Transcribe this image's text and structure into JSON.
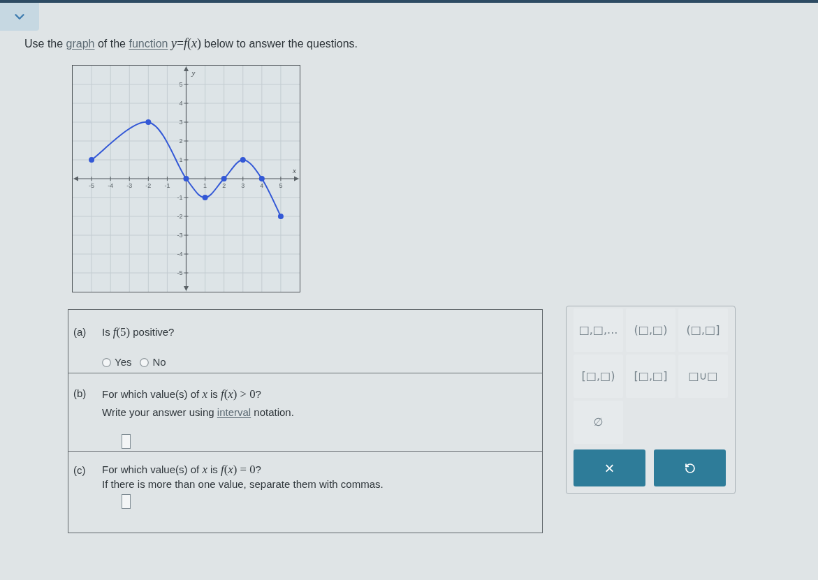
{
  "instruction": {
    "segments": [
      {
        "kind": "text",
        "text": "Use the "
      },
      {
        "kind": "link",
        "text": "graph"
      },
      {
        "kind": "text",
        "text": " of the "
      },
      {
        "kind": "link",
        "text": "function"
      },
      {
        "kind": "math",
        "text": " *y*=*f*(*x*)"
      },
      {
        "kind": "text",
        "text": " below to answer the questions."
      }
    ]
  },
  "graph": {
    "chart_data": [
      {
        "type": "line",
        "xlabel": "x",
        "ylabel": "y",
        "x": [
          -5,
          -2,
          0,
          1,
          2,
          3,
          4,
          5
        ],
        "values": [
          1,
          3,
          0,
          -1,
          0,
          1,
          0,
          -2
        ],
        "color": "#3358d6",
        "marker": "circle",
        "xlim": [
          -6,
          6
        ],
        "ylim": [
          -6,
          6
        ],
        "xticks": [
          -5,
          -4,
          -3,
          -2,
          -1,
          1,
          2,
          3,
          4,
          5
        ],
        "yticks": [
          -5,
          -4,
          -3,
          -2,
          -1,
          1,
          2,
          3,
          4,
          5
        ],
        "grid": true
      }
    ]
  },
  "questions": [
    {
      "label": "(a)",
      "lines": [
        {
          "segments": [
            {
              "kind": "text",
              "text": "Is "
            },
            {
              "kind": "math",
              "text": "*f*(5)"
            },
            {
              "kind": "text",
              "text": " positive?"
            }
          ]
        }
      ],
      "answer": {
        "kind": "radio",
        "options": [
          {
            "label": "Yes",
            "selected": false
          },
          {
            "label": "No",
            "selected": false
          }
        ]
      }
    },
    {
      "label": "(b)",
      "lines": [
        {
          "segments": [
            {
              "kind": "text",
              "text": "For which value(s) of "
            },
            {
              "kind": "math",
              "text": "*x*"
            },
            {
              "kind": "text",
              "text": " is "
            },
            {
              "kind": "math",
              "text": "*f*(*x*) > 0"
            },
            {
              "kind": "text",
              "text": "?"
            }
          ]
        },
        {
          "segments": [
            {
              "kind": "text",
              "text": "Write your answer using "
            },
            {
              "kind": "link",
              "text": "interval"
            },
            {
              "kind": "text",
              "text": " notation."
            }
          ]
        }
      ],
      "answer": {
        "kind": "box"
      }
    },
    {
      "label": "(c)",
      "lines": [
        {
          "segments": [
            {
              "kind": "text",
              "text": "For which value(s) of "
            },
            {
              "kind": "math",
              "text": "*x*"
            },
            {
              "kind": "text",
              "text": " is "
            },
            {
              "kind": "math",
              "text": "*f*(*x*) = 0"
            },
            {
              "kind": "text",
              "text": "?"
            }
          ]
        },
        {
          "segments": [
            {
              "kind": "text",
              "text": "If there is more than one value, separate them with commas."
            }
          ]
        }
      ],
      "answer": {
        "kind": "box"
      }
    }
  ],
  "keypad": {
    "keys": [
      {
        "text": "□,□,..."
      },
      {
        "text": "(□,□)"
      },
      {
        "text": "(□,□]"
      },
      {
        "text": "[□,□)"
      },
      {
        "text": "[□,□]"
      },
      {
        "text": "□∪□"
      },
      {
        "text": "∅"
      }
    ],
    "actions": [
      {
        "kind": "clear",
        "text": "×"
      },
      {
        "kind": "undo"
      }
    ]
  }
}
